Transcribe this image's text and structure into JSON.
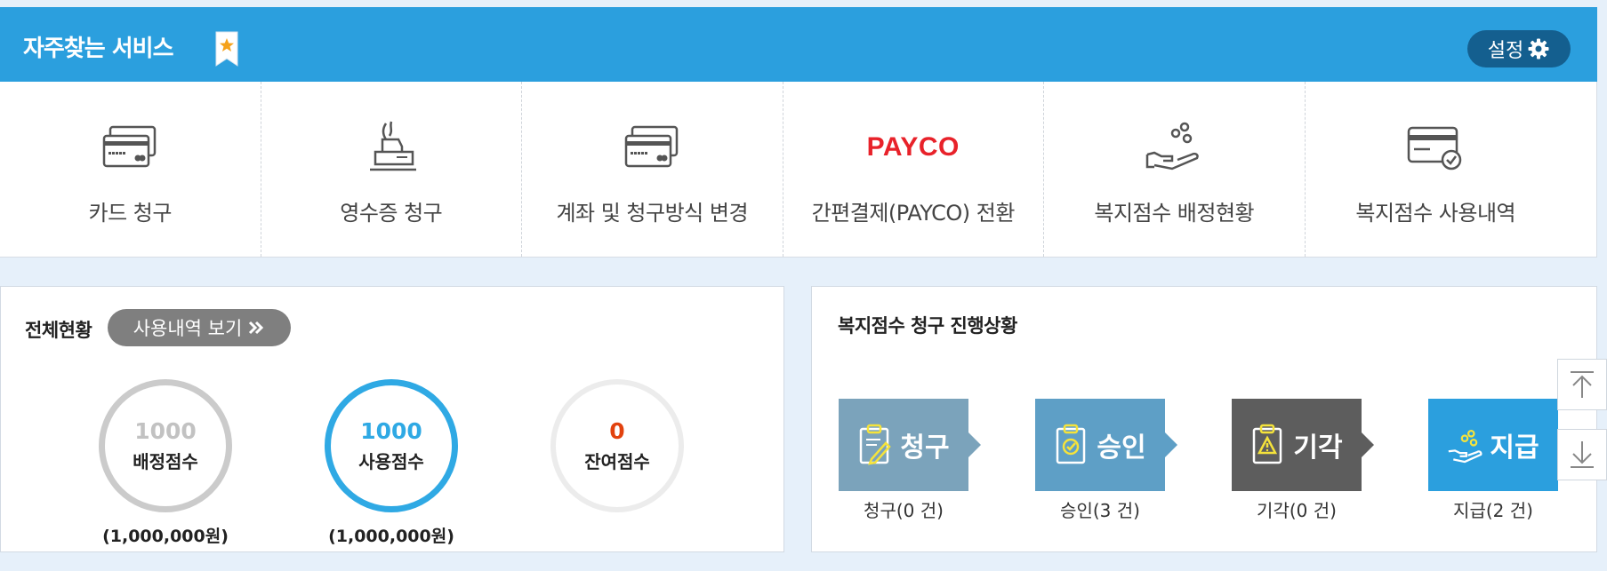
{
  "favorites": {
    "title": "자주찾는 서비스",
    "settings_label": "설정",
    "items": [
      {
        "label": "카드 청구",
        "icon": "credit-card-icon"
      },
      {
        "label": "영수증 청구",
        "icon": "receipt-icon"
      },
      {
        "label": "계좌 및 청구방식 변경",
        "icon": "credit-card-icon"
      },
      {
        "label": "간편결제(PAYCO) 전환",
        "icon": "payco-logo",
        "logo_text": "PAYCO"
      },
      {
        "label": "복지점수 배정현황",
        "icon": "hand-coins-icon"
      },
      {
        "label": "복지점수 사용내역",
        "icon": "card-check-icon"
      }
    ]
  },
  "overview": {
    "title": "전체현황",
    "history_button": "사용내역 보기",
    "scores": [
      {
        "value": "1000",
        "caption": "배정점수",
        "amount": "(1,000,000원)",
        "color": "#c2c2c2"
      },
      {
        "value": "1000",
        "caption": "사용점수",
        "amount": "(1,000,000원)",
        "color": "#2fa9e4"
      },
      {
        "value": "0",
        "caption": "잔여점수",
        "amount": "",
        "color": "#e2420e"
      }
    ]
  },
  "progress": {
    "title": "복지점수 청구 진행상황",
    "steps": [
      {
        "name": "청구",
        "label": "청구(0 건)",
        "color": "#7ba3bb"
      },
      {
        "name": "승인",
        "label": "승인(3 건)",
        "color": "#5e9fc6"
      },
      {
        "name": "기각",
        "label": "기각(0 건)",
        "color": "#5d5d5d"
      },
      {
        "name": "지급",
        "label": "지급(2 건)",
        "color": "#2b9fde"
      }
    ]
  },
  "colors": {
    "header": "#2b9fde",
    "background": "#e6f0fa",
    "payco": "#e8222a"
  }
}
